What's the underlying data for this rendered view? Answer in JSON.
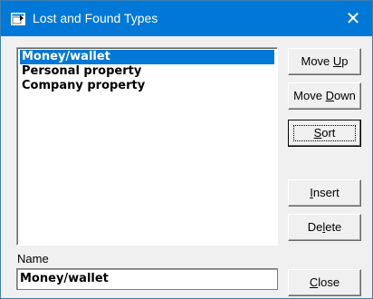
{
  "window": {
    "title": "Lost and Found Types",
    "close_glyph": "✕"
  },
  "list": {
    "items": [
      {
        "label": "Money/wallet",
        "selected": true
      },
      {
        "label": "Personal property",
        "selected": false
      },
      {
        "label": "Company property",
        "selected": false
      }
    ]
  },
  "name_field": {
    "label": "Name",
    "value": "Money/wallet"
  },
  "buttons": {
    "move_up": {
      "before": "Move ",
      "accel": "U",
      "after": "p"
    },
    "move_down": {
      "before": "Move ",
      "accel": "D",
      "after": "own"
    },
    "sort": {
      "before": "",
      "accel": "S",
      "after": "ort"
    },
    "insert": {
      "before": "",
      "accel": "I",
      "after": "nsert"
    },
    "delete": {
      "before": "De",
      "accel": "l",
      "after": "ete"
    },
    "close": {
      "before": "",
      "accel": "C",
      "after": "lose"
    }
  },
  "icons": {
    "title": "app-window-icon",
    "close": "close-icon"
  },
  "colors": {
    "titlebar": "#0078d7",
    "selection": "#0078d7",
    "dialog_bg": "#f0f0f0"
  }
}
